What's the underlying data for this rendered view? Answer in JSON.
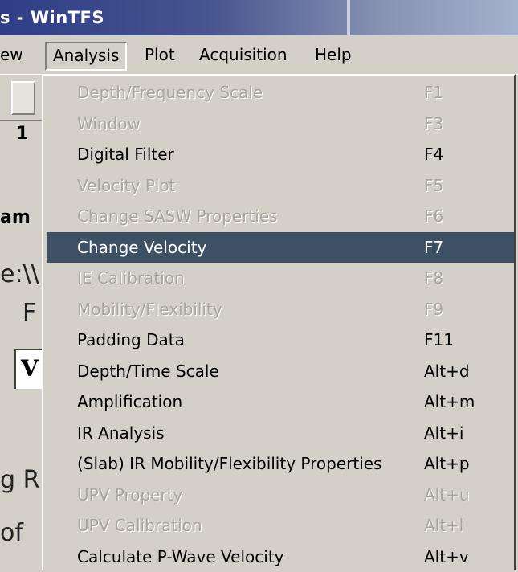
{
  "window": {
    "title": "s - WinTFS"
  },
  "menubar": {
    "items": [
      {
        "label": "ew"
      },
      {
        "label": "Analysis",
        "open": true
      },
      {
        "label": "Plot"
      },
      {
        "label": "Acquisition"
      },
      {
        "label": "Help"
      }
    ]
  },
  "background_fragments": {
    "tab_number": "1",
    "label_am": "am",
    "path_frag": "e:\\\\",
    "letter_f": "F",
    "field_char": "V",
    "letter_g": "g R",
    "letters_of": "of"
  },
  "analysis_menu": {
    "items": [
      {
        "label": "Depth/Frequency Scale",
        "shortcut": "F1",
        "enabled": false
      },
      {
        "label": "Window",
        "shortcut": "F3",
        "enabled": false
      },
      {
        "label": "Digital Filter",
        "shortcut": "F4",
        "enabled": true
      },
      {
        "label": "Velocity Plot",
        "shortcut": "F5",
        "enabled": false
      },
      {
        "label": "Change SASW Properties",
        "shortcut": "F6",
        "enabled": false
      },
      {
        "label": "Change Velocity",
        "shortcut": "F7",
        "enabled": true,
        "selected": true
      },
      {
        "label": "IE Calibration",
        "shortcut": "F8",
        "enabled": false
      },
      {
        "label": "Mobility/Flexibility",
        "shortcut": "F9",
        "enabled": false
      },
      {
        "label": "Padding Data",
        "shortcut": "F11",
        "enabled": true
      },
      {
        "label": "Depth/Time Scale",
        "shortcut": "Alt+d",
        "enabled": true
      },
      {
        "label": "Amplification",
        "shortcut": "Alt+m",
        "enabled": true
      },
      {
        "label": "IR Analysis",
        "shortcut": "Alt+i",
        "enabled": true
      },
      {
        "label": "(Slab) IR Mobility/Flexibility Properties",
        "shortcut": "Alt+p",
        "enabled": true
      },
      {
        "label": "UPV Property",
        "shortcut": "Alt+u",
        "enabled": false
      },
      {
        "label": "UPV Calibration",
        "shortcut": "Alt+l",
        "enabled": false
      },
      {
        "label": "Calculate P-Wave Velocity",
        "shortcut": "Alt+v",
        "enabled": true
      }
    ]
  },
  "colors": {
    "menu_bg": "#d4d0c8",
    "highlight_bg": "#3e5064",
    "disabled_text": "#a9a59d",
    "titlebar_start": "#2f3e86"
  }
}
